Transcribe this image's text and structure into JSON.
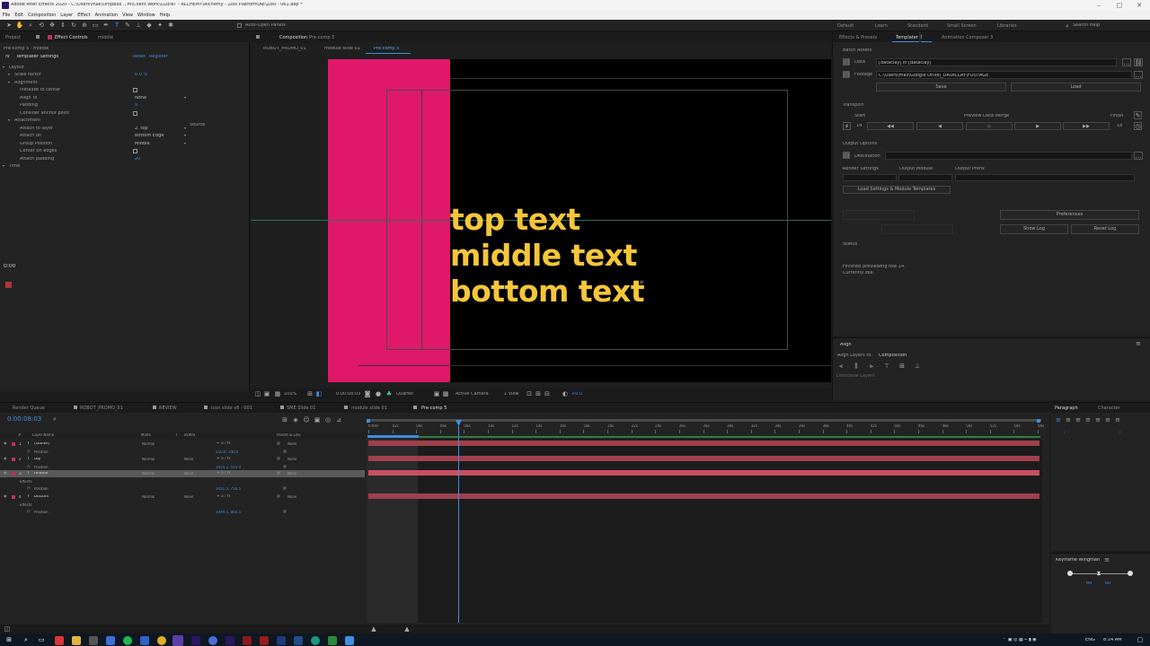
{
  "titlebar": {
    "title": "Adobe After Effects 2020 - C:\\Users\\mail\\Dropbox ...m\\Client Work\\CLIENT - ALCHEMY\\Alchemy - Zosi Platform\\AE\\Zosi - 061.aep *"
  },
  "menubar": [
    "File",
    "Edit",
    "Composition",
    "Layer",
    "Effect",
    "Animation",
    "View",
    "Window",
    "Help"
  ],
  "toolbar": {
    "auto_open": "Auto-Open Panels",
    "workspaces": [
      "Default",
      "Learn",
      "Standard",
      "Small Screen",
      "Libraries"
    ],
    "search_help": "Search Help"
  },
  "left_panel": {
    "tab_project": "Project",
    "tab_effect_controls": "Effect Controls",
    "tab_effect_target": "middle",
    "layer_path": "Pre-comp 5 · middle",
    "effect_name": "Templater Settings",
    "reset": "Reset",
    "register": "Register",
    "rows": [
      {
        "label": "Layout",
        "indent": 1,
        "value": ""
      },
      {
        "label": "Scale factor",
        "indent": 2,
        "value": "0.0 %"
      },
      {
        "label": "Alignment",
        "indent": 2,
        "value": ""
      },
      {
        "label": "Initialize to center",
        "indent": 3,
        "value": "checkbox"
      },
      {
        "label": "Align To",
        "indent": 3,
        "value": "None"
      },
      {
        "label": "Padding",
        "indent": 3,
        "value": "0"
      },
      {
        "label": "Consider anchor point",
        "indent": 3,
        "value": "checkbox"
      },
      {
        "label": "Attachment",
        "indent": 2,
        "value": ""
      },
      {
        "label": "Attach to layer",
        "indent": 3,
        "value": "2. top"
      },
      {
        "label": "Attach on",
        "indent": 3,
        "value": "Bottom Edge"
      },
      {
        "label": "Group Position",
        "indent": 3,
        "value": "Middle"
      },
      {
        "label": "Center on edges",
        "indent": 3,
        "value": "checkbox"
      },
      {
        "label": "Attach padding",
        "indent": 3,
        "value": "20"
      },
      {
        "label": "Time",
        "indent": 1,
        "value": ""
      }
    ],
    "source_label": "Source",
    "timecode_small": "0:00"
  },
  "comp_panel": {
    "tab_label": "Composition",
    "tab_comp": "Pre-comp 5",
    "breadcrumbs": [
      "ROBOT_PROMO_01",
      "module slide 01",
      "Pre-comp 5"
    ],
    "text_lines": [
      "top text",
      "middle text",
      "bottom text"
    ],
    "zoom": "100%",
    "timecode": "0:00:08:03",
    "resolution": "Quarter",
    "camera": "Active Camera",
    "views": "1 View",
    "exposure": "+0.0"
  },
  "right_panel": {
    "tabs": [
      "Effects & Presets",
      "Templater 2",
      "Animation Composer 3"
    ],
    "batch_assets": "Batch Assets",
    "data_label": "Data",
    "data_value": "[dataclay] in [dataclay]",
    "footage_label": "Footage",
    "footage_value": "C:\\Users\\mail\\Google Drive\\_DATACLAY\\FOOTAGE",
    "save": "Save",
    "load": "Load",
    "transport": "Transport",
    "start": "Start",
    "start_value": "14",
    "preview_merge": "Preview Data Merge",
    "finish": "Finish",
    "finish_value": "18",
    "output_options": "Output Options",
    "destination": "Destination",
    "render_settings": "Render Settings",
    "output_module": "Output Module",
    "output_prefix": "Output Prefix",
    "load_templates": "Load Settings & Module Templates",
    "preferences": "Preferences",
    "show_log": "Show Log",
    "reset_log": "Reset Log",
    "status": "Status",
    "status_msg1": "Finished previewing row 14.",
    "status_msg2": "Currently idle.",
    "align_title": "Align",
    "align_to_label": "Align Layers to:",
    "align_to_value": "Composition",
    "distribute": "Distribute Layers"
  },
  "timeline": {
    "tabs": [
      "Render Queue",
      "ROBOT_PROMO_01",
      "REVIEW",
      "icon slide v8 - 001",
      "SME Slide 01",
      "module slide 01",
      "Pre-comp 5"
    ],
    "timecode": "0:00:08:03",
    "header": {
      "num": "#",
      "name": "Layer Name",
      "mode": "Mode",
      "t": "T",
      "trkmat": "TrkMat",
      "parent": "Parent & Link"
    },
    "layers": [
      {
        "num": "1",
        "name": "[Guide]",
        "mode": "Normal",
        "trk": "",
        "parent": "None",
        "type": "layer",
        "color": "#c0305a"
      },
      {
        "num": "",
        "name": "Position",
        "mode": "",
        "trk": "",
        "parent": "",
        "type": "prop",
        "value": "550.0, 540.0"
      },
      {
        "num": "2",
        "name": "top",
        "mode": "Normal",
        "trk": "None",
        "parent": "None",
        "type": "layer",
        "color": "#c0305a"
      },
      {
        "num": "",
        "name": "Position",
        "mode": "",
        "trk": "",
        "parent": "",
        "type": "prop",
        "value": "1054.2, 415.0"
      },
      {
        "num": "3",
        "name": "middle",
        "mode": "Normal",
        "trk": "None",
        "parent": "None",
        "type": "layer",
        "color": "#c0305a",
        "selected": true
      },
      {
        "num": "",
        "name": "Effects",
        "mode": "",
        "trk": "",
        "parent": "",
        "type": "group",
        "value": ""
      },
      {
        "num": "",
        "name": "Position",
        "mode": "",
        "trk": "",
        "parent": "",
        "type": "prop",
        "value": "1051.5, 750.5"
      },
      {
        "num": "4",
        "name": "bottom",
        "mode": "Normal",
        "trk": "None",
        "parent": "None",
        "type": "layer",
        "color": "#c0305a"
      },
      {
        "num": "",
        "name": "Effects",
        "mode": "",
        "trk": "",
        "parent": "",
        "type": "group",
        "value": ""
      },
      {
        "num": "",
        "name": "Position",
        "mode": "",
        "trk": "",
        "parent": "",
        "type": "prop",
        "value": "1049.5, 864.5"
      }
    ],
    "ruler": [
      "0:00s",
      "02s",
      "04s",
      "06s",
      "08s",
      "10s",
      "12s",
      "14s",
      "16s",
      "18s",
      "20s",
      "22s",
      "24s",
      "26s",
      "28s",
      "30s",
      "32s",
      "34s",
      "36s",
      "38s",
      "40s",
      "42s",
      "44s",
      "46s",
      "48s",
      "50s",
      "52s",
      "54s",
      "56s"
    ]
  },
  "paragraph_panel": {
    "tabs": [
      "Paragraph",
      "Character"
    ]
  },
  "keyframe_wingman": {
    "title": "Keyframe Wingman",
    "left": "60",
    "right": "60"
  },
  "taskbar": {
    "lang": "ENG",
    "time": "8:14 AM"
  },
  "colors": {
    "accent_blue": "#3f8fe0",
    "layer_pink": "#e0186a",
    "text_yellow": "#f5c63a",
    "layer_bar": "#a0404c"
  }
}
